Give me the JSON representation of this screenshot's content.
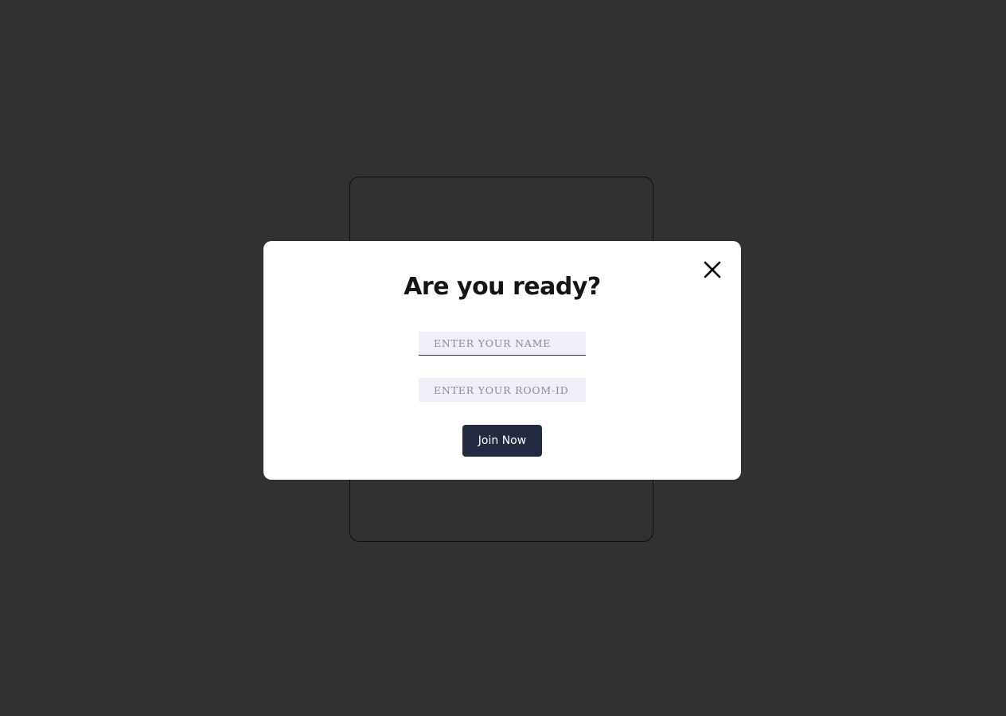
{
  "modal": {
    "title": "Are you ready?",
    "name_placeholder": "ENTER YOUR NAME",
    "room_placeholder": "ENTER YOUR ROOM-ID",
    "join_label": "Join Now",
    "close_icon": "close-icon"
  },
  "colors": {
    "page_background": "#313131",
    "modal_background": "#ffffff",
    "input_background": "#efeff9",
    "button_background": "#232b43",
    "title_text": "#151515"
  }
}
